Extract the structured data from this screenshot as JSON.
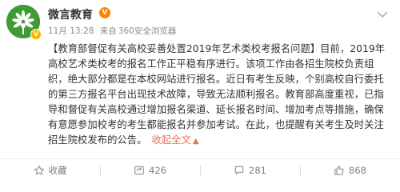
{
  "post": {
    "author": "微言教育",
    "verified_badge": "V",
    "time": "11月 13:28",
    "source_prefix": "来自",
    "source": "360安全浏览器",
    "text": "【教育部督促有关高校妥善处置2019年艺术类校考报名问题】目前，2019年高校艺术类校考的报名工作正平稳有序进行。该项工作由各招生院校负责组织，绝大部分都是在本校网站进行报名。近日有考生反映，个别高校自行委托的第三方报名平台出现技术故障，导致无法顺利报名。教育部高度重视，已指导和督促有关高校通过增加报名渠道、延长报名时间、增加考点等措施，确保有意愿参加校考的考生都能报名并参加考试。在此，也提醒有关考生及时关注招生院校发布的公告。",
    "collapse_label": "收起全文",
    "icons": {
      "avatar": "green-leaf-logo",
      "menu": "chevron-down-icon",
      "favorite": "star-icon",
      "repost": "repost-icon",
      "comment": "comment-icon",
      "like": "thumbs-up-icon"
    }
  },
  "actions": {
    "favorite_label": "收藏",
    "repost_count": "426",
    "comment_count": "281",
    "like_count": "868"
  },
  "colors": {
    "link": "#eb7350",
    "muted": "#808080",
    "brand": "#3f9c35"
  }
}
